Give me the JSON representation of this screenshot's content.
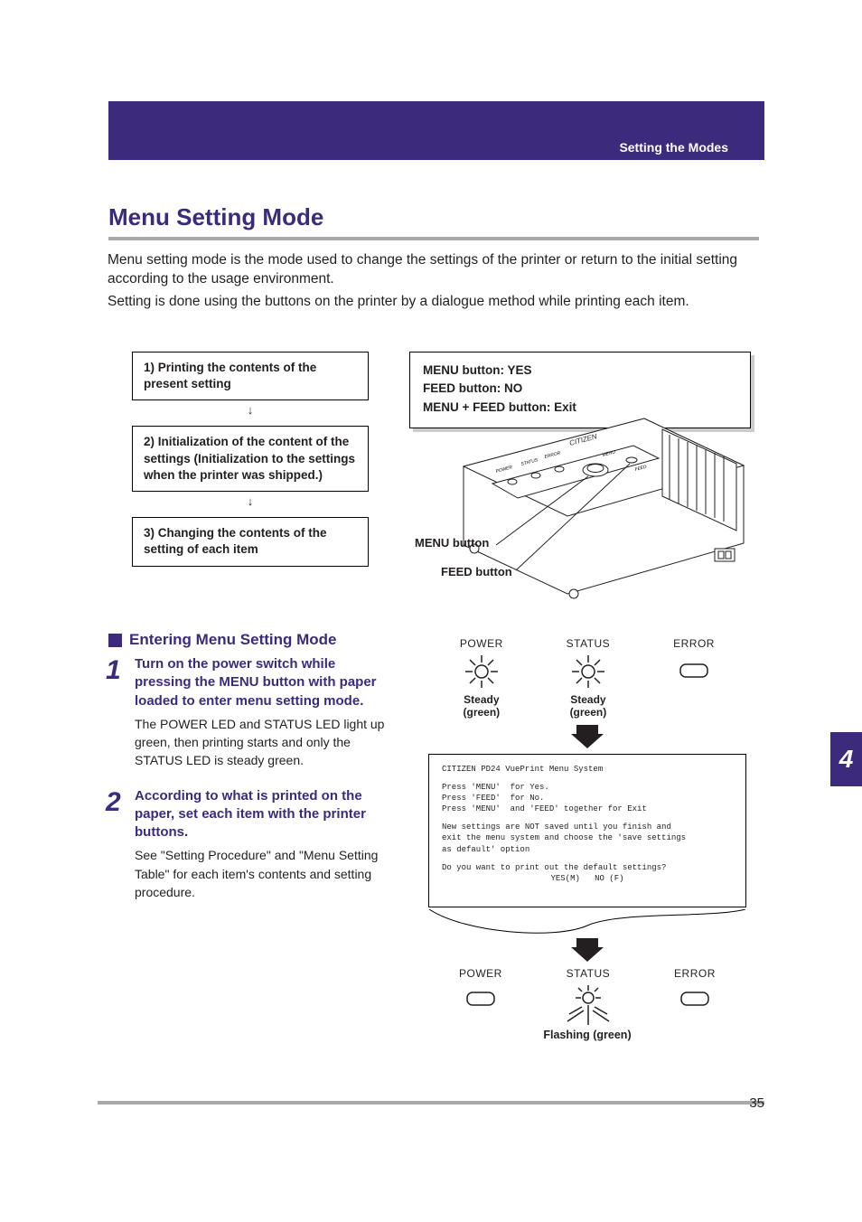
{
  "header": {
    "section_label": "Setting the Modes"
  },
  "title": "Menu Setting Mode",
  "intro_p1": "Menu setting mode is the mode used to change the settings of the printer or return to the initial setting according to the usage environment.",
  "intro_p2": "Setting is done using the buttons on the printer by a dialogue method while printing each item.",
  "flow": {
    "box1": "1) Printing the contents of the present setting",
    "box2": "2) Initialization of the content of the settings (Initialization to the settings when the printer was shipped.)",
    "box3": "3) Changing the contents of the setting of each item",
    "arrow": "↓"
  },
  "right_box": {
    "l1": "MENU button: YES",
    "l2": "FEED button: NO",
    "l3": "MENU + FEED button: Exit"
  },
  "printer_labels": {
    "menu": "MENU button",
    "feed": "FEED button",
    "brand": "CITIZEN",
    "top_power": "POWER",
    "top_status": "STATUS",
    "top_error": "ERROR",
    "top_menu": "MENU",
    "top_feed": "FEED"
  },
  "subtitle": "Entering Menu Setting Mode",
  "steps": [
    {
      "num": "1",
      "bold": "Turn on the power switch while pressing the MENU button with paper loaded to enter menu setting mode.",
      "desc": "The POWER LED and STATUS LED light up green, then printing starts and only the STATUS LED is steady green."
    },
    {
      "num": "2",
      "bold": "According to what is printed on the paper, set each item with the printer buttons.",
      "desc": "See \"Setting Procedure\" and \"Menu Setting Table\" for each item's contents and setting procedure."
    }
  ],
  "led": {
    "power": "POWER",
    "status": "STATUS",
    "error": "ERROR",
    "steady_green": "Steady\n(green)",
    "flashing_green": "Flashing (green)"
  },
  "printout": {
    "l1": "CITIZEN PD24 VuePrint Menu System",
    "l2": "Press 'MENU'  for Yes.",
    "l3": "Press 'FEED'  for No.",
    "l4": "Press 'MENU'  and 'FEED' together for Exit",
    "l5": "New settings are NOT saved until you finish and",
    "l6": "exit the menu system and choose the 'save settings",
    "l7": "as default' option",
    "l8": "Do you want to print out the default settings?",
    "l9": "YES(M)   NO (F)"
  },
  "chapter_tab": "4",
  "page_number": "35"
}
